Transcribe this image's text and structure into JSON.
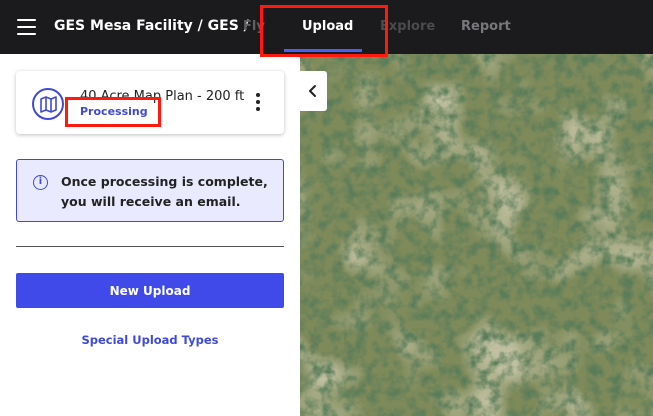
{
  "header": {
    "breadcrumb": "GES Mesa Facility / GES /",
    "tabs": [
      {
        "label": "Fly"
      },
      {
        "label": "Upload"
      },
      {
        "label": "Explore"
      },
      {
        "label": "Report"
      }
    ],
    "active_tab": "Upload"
  },
  "plan_card": {
    "title": "40 Acre Map Plan - 200 ft",
    "status": "Processing",
    "icon": "map-icon"
  },
  "info": {
    "message": "Once processing is complete, you will receive an email.",
    "icon": "info-icon"
  },
  "actions": {
    "new_upload": "New Upload",
    "special_upload_types": "Special Upload Types"
  },
  "colors": {
    "accent": "#3f4ae8",
    "topbar": "#1b1b1d",
    "highlight": "#ff1a0f",
    "info_bg": "#eaeaff"
  }
}
